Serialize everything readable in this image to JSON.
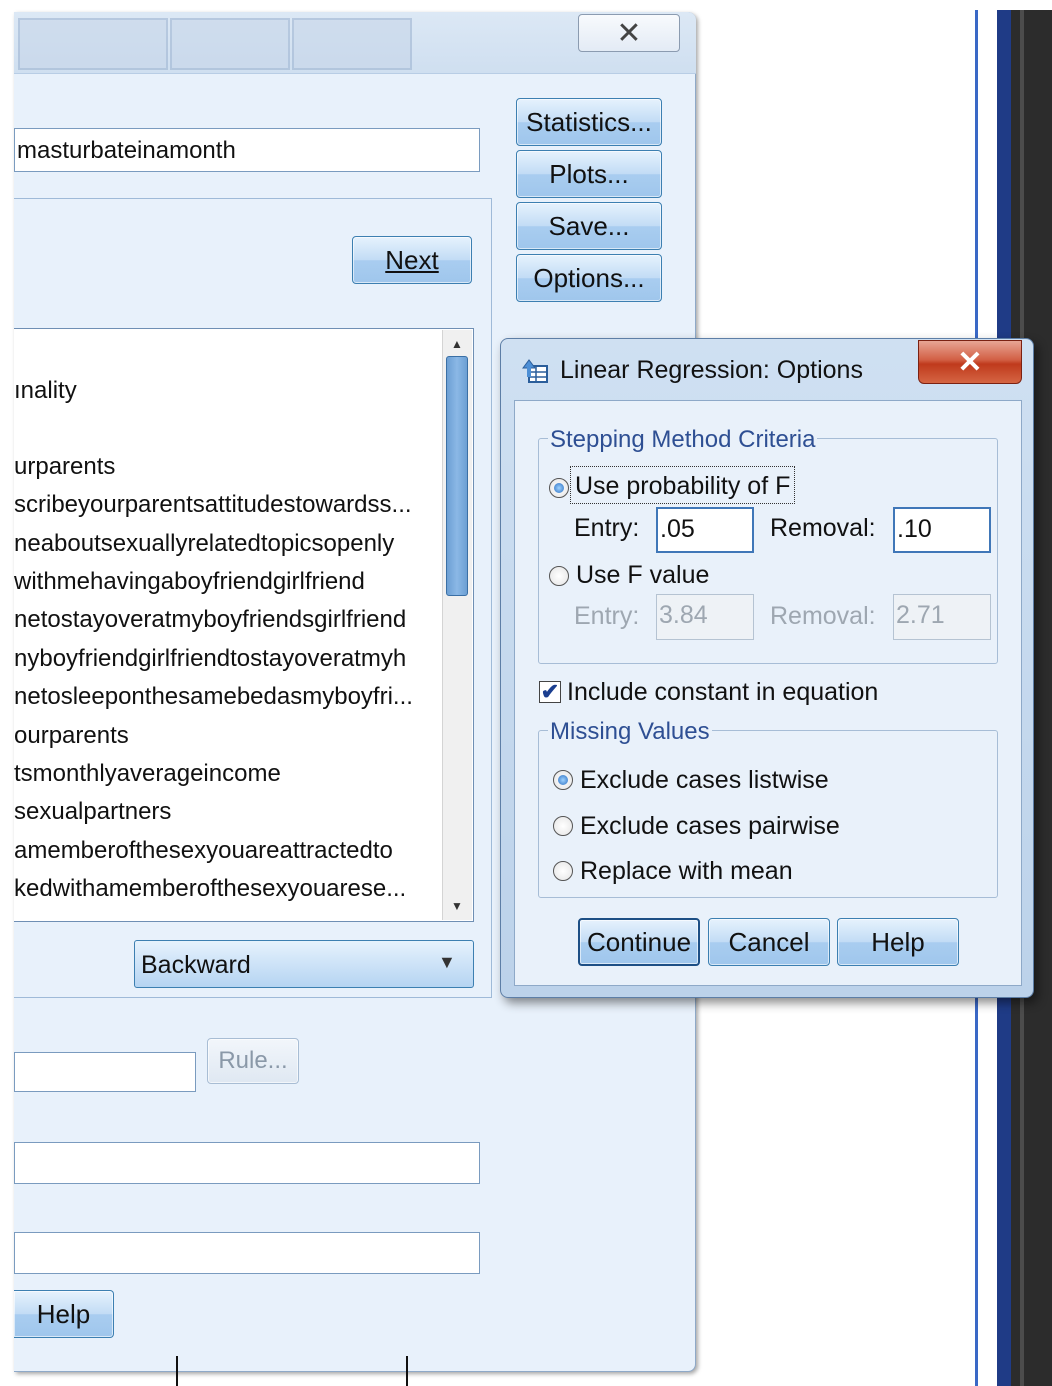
{
  "main_dialog": {
    "close_glyph": "✕",
    "dependent_value": "masturbateinamonth",
    "next_label": "Next",
    "side_buttons": {
      "statistics": "Statistics...",
      "plots": "Plots...",
      "save": "Save...",
      "options": "Options..."
    },
    "variables": [
      "ınality",
      "",
      "urparents",
      "scribeyourparentsattitudestowardss...",
      "neaboutsexuallyrelatedtopicsopenly",
      "withmehavingaboyfriendgirlfriend",
      "netostayoveratmyboyfriendsgirlfriend",
      "nyboyfriendgirlfriendtostayoveratmyh",
      "netosleeponthesamebedasmyboyfri...",
      "ourparents",
      "tsmonthlyaverageincome",
      "sexualpartners",
      "amemberofthesexyouareattractedto",
      "kedwithamemberofthesexyouarese..."
    ],
    "method_value": "Backward",
    "rule_label": "Rule...",
    "help_label": "Help"
  },
  "options_dialog": {
    "title": "Linear Regression: Options",
    "close_glyph": "✕",
    "stepping": {
      "legend": "Stepping Method Criteria",
      "use_probability_label": "Use probability of F",
      "prob_entry_label": "Entry:",
      "prob_entry_value": ".05",
      "prob_removal_label": "Removal:",
      "prob_removal_value": ".10",
      "use_f_label": "Use F value",
      "f_entry_label": "Entry:",
      "f_entry_value": "3.84",
      "f_removal_label": "Removal:",
      "f_removal_value": "2.71",
      "selected": "probability"
    },
    "include_constant_label": "Include constant in equation",
    "include_constant_checked": true,
    "check_glyph": "✔",
    "missing": {
      "legend": "Missing Values",
      "listwise_label": "Exclude cases listwise",
      "pairwise_label": "Exclude cases pairwise",
      "mean_label": "Replace with mean",
      "selected": "listwise"
    },
    "buttons": {
      "continue": "Continue",
      "cancel": "Cancel",
      "help": "Help"
    }
  },
  "colors": {
    "dialog_bg": "#e8f1fb",
    "button_border": "#3c7fb1",
    "close_red": "#bf3a1c",
    "group_label": "#2e4f93"
  }
}
